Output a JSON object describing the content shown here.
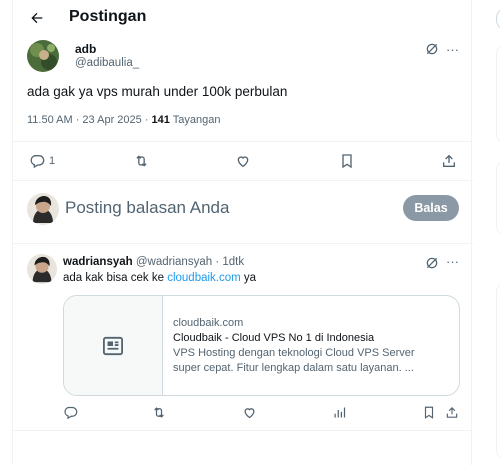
{
  "header": {
    "title": "Postingan"
  },
  "post": {
    "display_name": "adb",
    "handle": "@adibaulia_",
    "text": "ada gak ya vps murah under 100k perbulan",
    "time": "11.50 AM · 23 Apr 2025 · ",
    "views_count": "141",
    "views_label": " Tayangan",
    "reply_count": "1",
    "more": "···"
  },
  "reply_composer": {
    "prompt": "Posting balasan Anda",
    "button_label": "Balas"
  },
  "reply": {
    "display_name": "wadriansyah",
    "handle": "@wadriansyah",
    "age": " · 1dtk",
    "text_before": "ada kak bisa cek ke ",
    "link_text": "cloudbaik.com",
    "text_after": " ya",
    "more": "···",
    "card": {
      "domain": "cloudbaik.com",
      "title": "Cloudbaik - Cloud VPS No 1 di Indonesia",
      "description_line1": "VPS Hosting dengan teknologi Cloud VPS Server",
      "description_line2": "super cepat. Fitur lengkap dalam satu layanan. ..."
    }
  },
  "colors": {
    "text": "#0f1419",
    "muted": "#536471",
    "link": "#1d9bf0",
    "border": "#eff3f4",
    "button_disabled": "#8b98a5"
  }
}
